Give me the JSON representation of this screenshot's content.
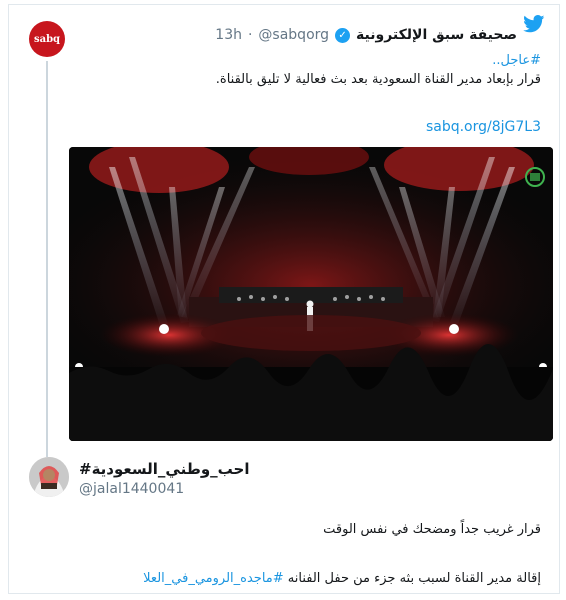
{
  "tweet": {
    "avatar_text": "sabq",
    "display_name": "صحيفة سبق الإلكترونية",
    "handle": "@sabqorg",
    "separator": "·",
    "time": "13h",
    "hashtag": "#عاجل..",
    "body": "قرار بإبعاد مدير القناة السعودية بعد بث فعالية لا تليق بالقناة.",
    "link": "sabq.org/8jG7L3"
  },
  "reply": {
    "display_name": "احب_وطني_السعودية#",
    "handle": "@jalal1440041",
    "line1": "قرار غريب جداً ومضحك في نفس الوقت",
    "line2_prefix": "إقالة مدير القناة لسبب بثه جزء من حفل الفنانه",
    "line2_hashtag": "#ماجده_الرومي_في_العلا"
  },
  "icons": {
    "brand": "twitter-bird-icon",
    "verified": "verified-badge-icon"
  },
  "colors": {
    "link": "#1b95e0",
    "brand": "#1da1f2",
    "muted": "#657786",
    "avatar_red": "#c7161d"
  }
}
